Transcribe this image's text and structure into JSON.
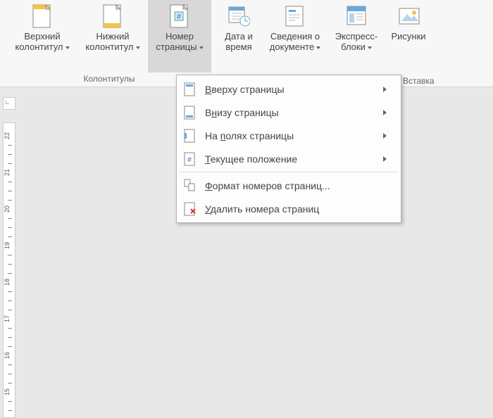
{
  "ribbon": {
    "groups": {
      "header_footer_label": "Колонтитулы",
      "insert_label": "Вставка"
    },
    "buttons": {
      "header": {
        "line1": "Верхний",
        "line2": "колонтитул"
      },
      "footer": {
        "line1": "Нижний",
        "line2": "колонтитул"
      },
      "page_number": {
        "line1": "Номер",
        "line2": "страницы"
      },
      "date_time": {
        "line1": "Дата и",
        "line2": "время"
      },
      "doc_info": {
        "line1": "Сведения о",
        "line2": "документе"
      },
      "quick_parts": {
        "line1": "Экспресс-",
        "line2": "блоки"
      },
      "pictures": {
        "line1": "Рисунки",
        "line2": ""
      }
    }
  },
  "menu": {
    "top_of_page": "Вверху страницы",
    "bottom_of_page": "Внизу страницы",
    "page_margins": "На полях страницы",
    "current_position": "Текущее положение",
    "format_numbers": "Формат номеров страниц...",
    "remove_numbers": "Удалить номера страниц"
  },
  "ruler": {
    "marks": [
      "22",
      "21",
      "20",
      "19",
      "18",
      "17",
      "16",
      "15"
    ]
  }
}
